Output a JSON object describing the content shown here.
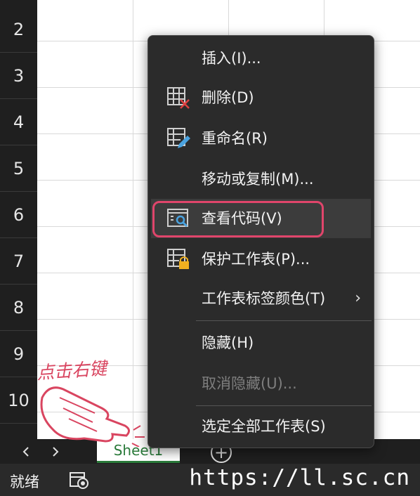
{
  "rows": [
    "2",
    "3",
    "4",
    "5",
    "6",
    "7",
    "8",
    "9",
    "10"
  ],
  "sheet_tab": "Sheet1",
  "nav": {
    "prev": "◀",
    "next": "▶"
  },
  "add_sheet": "+",
  "status": {
    "ready": "就绪"
  },
  "watermark": "https://ll.sc.cn",
  "annotation": "点击右键",
  "context_menu": {
    "items": [
      {
        "label": "插入(I)...",
        "icon": "insert"
      },
      {
        "label": "删除(D)",
        "icon": "delete-sheet-icon"
      },
      {
        "label": "重命名(R)",
        "icon": "rename-sheet-icon"
      },
      {
        "label": "移动或复制(M)...",
        "icon": ""
      },
      {
        "label": "查看代码(V)",
        "icon": "view-code-icon",
        "highlighted": true
      },
      {
        "label": "保护工作表(P)...",
        "icon": "protect-sheet-icon"
      },
      {
        "label": "工作表标签颜色(T)",
        "icon": "",
        "submenu": "›"
      },
      {
        "label": "隐藏(H)",
        "icon": ""
      },
      {
        "label": "取消隐藏(U)...",
        "icon": "",
        "disabled": true
      },
      {
        "label": "选定全部工作表(S)",
        "icon": ""
      }
    ]
  },
  "colors": {
    "menu_bg": "#2b2b2b",
    "highlight_border": "#e0456b",
    "sheet_tab_accent": "#2a7a3a",
    "annotation": "#d94560"
  }
}
